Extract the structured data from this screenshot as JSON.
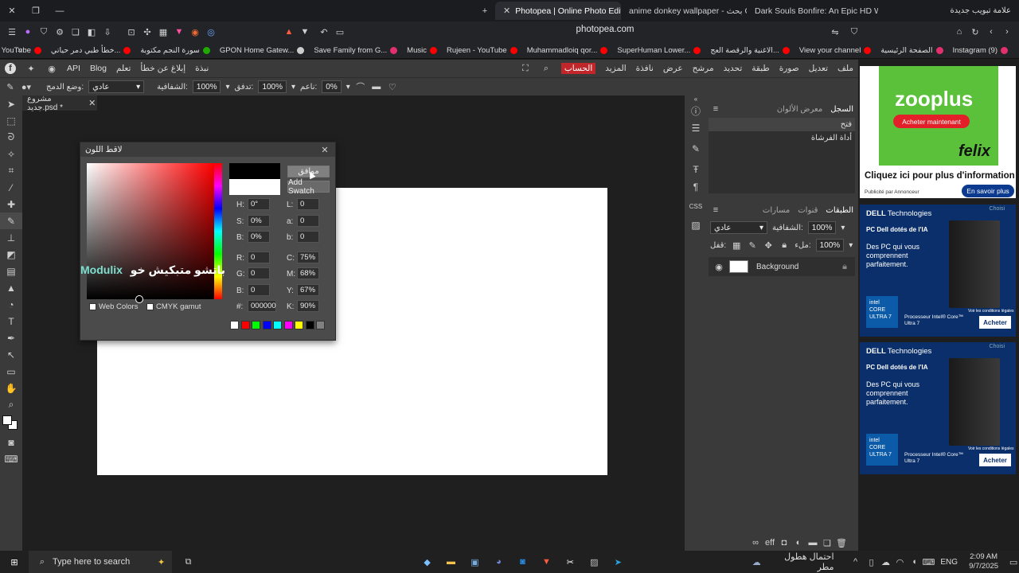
{
  "browser": {
    "tabs": [
      {
        "title": "Photopea | Online Photo Editor",
        "active": true
      },
      {
        "title": "anime donkey wallpaper - بحث Goog",
        "active": false
      },
      {
        "title": "Dark Souls Bonfire: An Epic HD Wallp",
        "active": false
      }
    ],
    "new_tab_label": "علامة تبويب جديدة",
    "address": "photopea.com",
    "bookmarks": [
      {
        "label": "YouTube",
        "color": "#ff0000"
      },
      {
        "label": "خطأ طبي دمر حياتي...",
        "color": "#ff0000"
      },
      {
        "label": "سورة النجم مكتوبة",
        "color": "#1faa00"
      },
      {
        "label": "GPON Home Gatew...",
        "color": "#cccccc"
      },
      {
        "label": "Save Family from G...",
        "color": "#e1306c"
      },
      {
        "label": "Music",
        "color": "#ff0000"
      },
      {
        "label": "Rujeen - YouTube",
        "color": "#ff0000"
      },
      {
        "label": "Muhammadloiq qor...",
        "color": "#ff0000"
      },
      {
        "label": "SuperHuman Lower...",
        "color": "#ff0000"
      },
      {
        "label": "الاغنية والرقصة العج...",
        "color": "#ff0000"
      },
      {
        "label": "View your channel",
        "color": "#ff0000"
      },
      {
        "label": "الصفحة الرئيسية",
        "color": "#e1306c"
      },
      {
        "label": "Instagram (9)",
        "color": "#e1306c"
      }
    ]
  },
  "photopea": {
    "menu": [
      "ملف",
      "تعديل",
      "صورة",
      "طبقة",
      "تحديد",
      "مرشح",
      "عرض",
      "نافذة",
      "المزيد",
      "الحساب"
    ],
    "menu_right": [
      "API",
      "Blog",
      "تعلم",
      "إبلاغ عن خطأ",
      "نبذة"
    ],
    "options": {
      "blend_label": "وضع الدمج:",
      "blend_value": "عادي",
      "opacity_label": "الشفافية:",
      "opacity_value": "100%",
      "flow_label": "تدفق:",
      "flow_value": "100%",
      "smooth_label": "ناعم:",
      "smooth_value": "0%"
    },
    "doc_tab": "مشروع جديد.psd *",
    "history": {
      "tabs": [
        "السجل",
        "معرض الألوان"
      ],
      "items": [
        "فتح",
        "أداة الفرشاة"
      ]
    },
    "layers": {
      "tabs": [
        "الطبقات",
        "قنوات",
        "مسارات"
      ],
      "blend": "عادي",
      "opacity_label": "الشفافية:",
      "opacity": "100%",
      "lock_label": "قفل:",
      "fill_label": "ملء:",
      "fill": "100%",
      "layer_name": "Background"
    },
    "color_picker": {
      "title": "لاقط اللون",
      "ok": "موافق",
      "add_swatch": "Add Swatch",
      "H": "0°",
      "S": "0%",
      "B": "0%",
      "R": "0",
      "G": "0",
      "Bl": "0",
      "L": "0",
      "a": "0",
      "b": "0",
      "C": "75%",
      "M": "68%",
      "Y": "67%",
      "K": "90%",
      "hex_label": "#:",
      "hex": "000000",
      "web_colors": "Web Colors",
      "cmyk_gamut": "CMYK gamut",
      "watermark_en": "Modulix",
      "watermark_ar": "باتشو متبكيش خو",
      "swatches": [
        "#ffffff",
        "#ff0000",
        "#00ff00",
        "#0000ff",
        "#00ffff",
        "#ff00ff",
        "#ffff00",
        "#000000",
        "#808080"
      ]
    }
  },
  "ads": {
    "zooplus": {
      "brand": "zooplus",
      "button": "Acheter maintenant",
      "product": "felix",
      "headline": "Cliquez ici pour plus d'information",
      "publisher": "Publicité par Annonceur",
      "cta": "En savoir plus"
    },
    "dell": {
      "choice": "Choisi",
      "brand": "DELL",
      "brand_suffix": "Technologies",
      "tagline": "PC Dell dotés de l'IA",
      "body": "Des PC qui vous comprennent parfaitement.",
      "chip": "intel CORE",
      "chip_sub": "ULTRA 7",
      "processor": "Processeur Intel® Core™ Ultra 7",
      "legal": "Voir les conditions légales",
      "cta": "Acheter"
    }
  },
  "taskbar": {
    "search_placeholder": "Type here to search",
    "weather": "احتمال هطول مطر",
    "language": "ENG",
    "time": "2:09 AM",
    "date": "9/7/2025"
  }
}
